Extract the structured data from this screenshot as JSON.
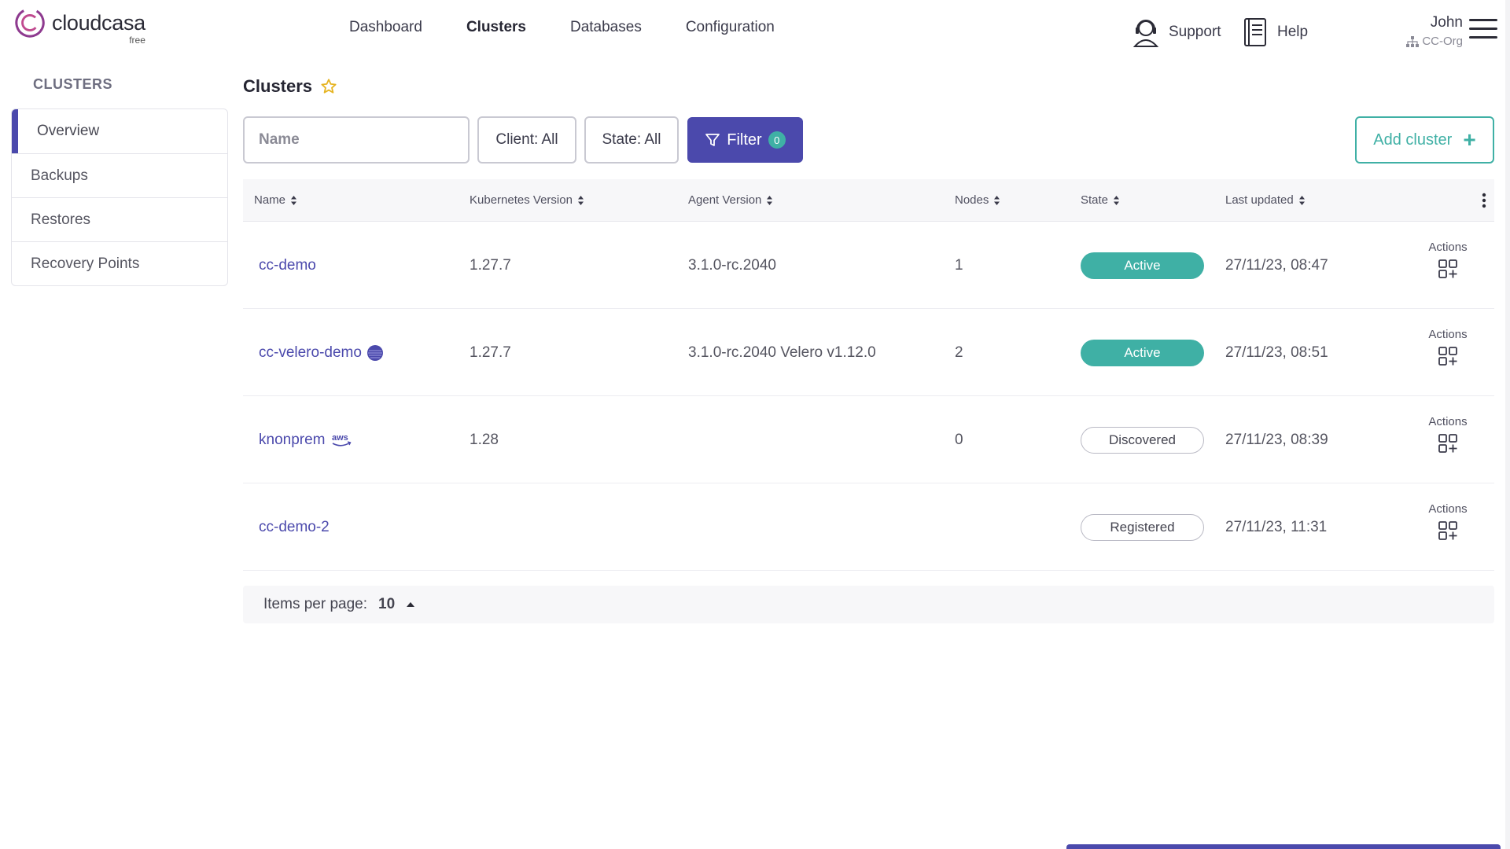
{
  "brand": {
    "name": "cloudcasa",
    "plan": "free",
    "color": "#8e3a8f"
  },
  "nav": {
    "items": [
      {
        "label": "Dashboard",
        "active": false
      },
      {
        "label": "Clusters",
        "active": true
      },
      {
        "label": "Databases",
        "active": false
      },
      {
        "label": "Configuration",
        "active": false
      }
    ]
  },
  "topbar": {
    "support_label": "Support",
    "help_label": "Help",
    "user_name": "John",
    "org_name": "CC-Org"
  },
  "sidebar": {
    "title": "CLUSTERS",
    "items": [
      {
        "label": "Overview",
        "active": true
      },
      {
        "label": "Backups",
        "active": false
      },
      {
        "label": "Restores",
        "active": false
      },
      {
        "label": "Recovery Points",
        "active": false
      }
    ]
  },
  "page": {
    "title": "Clusters"
  },
  "toolbar": {
    "name_placeholder": "Name",
    "client_label": "Client: All",
    "state_label": "State: All",
    "filter_label": "Filter",
    "filter_count": "0",
    "add_label": "Add cluster"
  },
  "table": {
    "columns": [
      "Name",
      "Kubernetes Version",
      "Agent Version",
      "Nodes",
      "State",
      "Last updated"
    ],
    "actions_label": "Actions",
    "rows": [
      {
        "name": "cc-demo",
        "icon": "",
        "k8s": "1.27.7",
        "agent": "3.1.0-rc.2040",
        "nodes": "1",
        "state": "Active",
        "state_style": "active",
        "updated": "27/11/23, 08:47"
      },
      {
        "name": "cc-velero-demo",
        "icon": "velero-icon",
        "k8s": "1.27.7",
        "agent": "3.1.0-rc.2040 Velero v1.12.0",
        "nodes": "2",
        "state": "Active",
        "state_style": "active",
        "updated": "27/11/23, 08:51"
      },
      {
        "name": "knonprem",
        "icon": "aws-icon",
        "k8s": "1.28",
        "agent": "",
        "nodes": "0",
        "state": "Discovered",
        "state_style": "outline",
        "updated": "27/11/23, 08:39"
      },
      {
        "name": "cc-demo-2",
        "icon": "",
        "k8s": "",
        "agent": "",
        "nodes": "",
        "state": "Registered",
        "state_style": "outline",
        "updated": "27/11/23, 11:31"
      }
    ]
  },
  "pager": {
    "label": "Items per page:",
    "value": "10"
  },
  "colors": {
    "primary": "#4b49ac",
    "accent": "#3fb0a5",
    "star": "#e6b422"
  }
}
